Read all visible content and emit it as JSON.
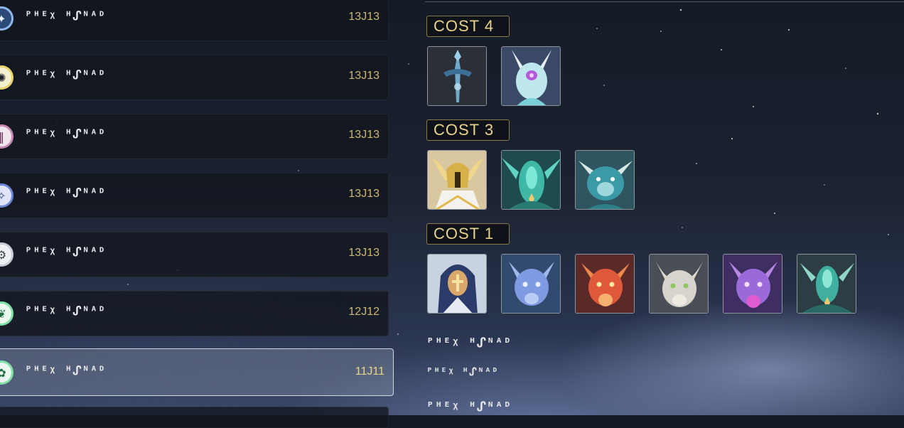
{
  "list": {
    "items": [
      {
        "label": "ᴾᴴᴱᵡ ᴴᔑᴺᴬᴰ",
        "count": "13J13",
        "icon": "star-emblem-icon",
        "ring": "#8fb8e8",
        "inner": "#2b4a7a",
        "glyph": "✦"
      },
      {
        "label": "ᴾᴴᴱᵡ ᴴᔑᴺᴬᴰ",
        "count": "13J13",
        "icon": "sun-emblem-icon",
        "ring": "#e8d36a",
        "inner": "#f4f1d0",
        "glyph": "✺"
      },
      {
        "label": "ᴾᴴᴱᵡ ᴴᔑᴺᴬᴰ",
        "count": "13J13",
        "icon": "pillar-emblem-icon",
        "ring": "#c88ab0",
        "inner": "#f0e6ee",
        "glyph": "‖"
      },
      {
        "label": "ᴾᴴᴱᵡ ᴴᔑᴺᴬᴰ",
        "count": "13J13",
        "icon": "sparkle-emblem-icon",
        "ring": "#6f86d8",
        "inner": "#dfe4f6",
        "glyph": "✧"
      },
      {
        "label": "ᴾᴴᴱᵡ ᴴᔑᴺᴬᴰ",
        "count": "13J13",
        "icon": "gear-emblem-icon",
        "ring": "#c8ccd4",
        "inner": "#eef0f3",
        "glyph": "⚙"
      },
      {
        "label": "ᴾᴴᴱᵡ ᴴᔑᴺᴬᴰ",
        "count": "12J12",
        "icon": "leaf-emblem-icon",
        "ring": "#7fe0a8",
        "inner": "#eaf8ef",
        "glyph": "❦"
      },
      {
        "label": "ᴾᴴᴱᵡ ᴴᔑᴺᴬᴰ",
        "count": "11J11",
        "icon": "swirl-emblem-icon",
        "ring": "#7fe0a8",
        "inner": "#eaf8ef",
        "glyph": "✿"
      }
    ]
  },
  "costs": [
    {
      "label": "COST  4",
      "cards": [
        "sword-dragon",
        "horned-crystal-dragon"
      ]
    },
    {
      "label": "COST  3",
      "cards": [
        "golden-helm-knight",
        "teal-crystal-dragon",
        "aqua-dragon"
      ]
    },
    {
      "label": "COST  1",
      "cards": [
        "hooded-nun",
        "blue-dragon",
        "red-dragon",
        "white-dragon",
        "purple-dragon",
        "teal-cloak-dragon"
      ]
    }
  ],
  "bottom": {
    "label1": "ᴾᴴᴱᵡ ᴴᔑᴺᴬᴰ",
    "label2": "ᴾᴴᴱᵡ ᴴᔑᴺᴬᴰ",
    "label3": "ᴾᴴᴱᵡ ᴴᔑᴺᴬᴰ"
  },
  "colors": {
    "accent_gold": "#e8d38c",
    "count_gold": "#cdb772"
  }
}
